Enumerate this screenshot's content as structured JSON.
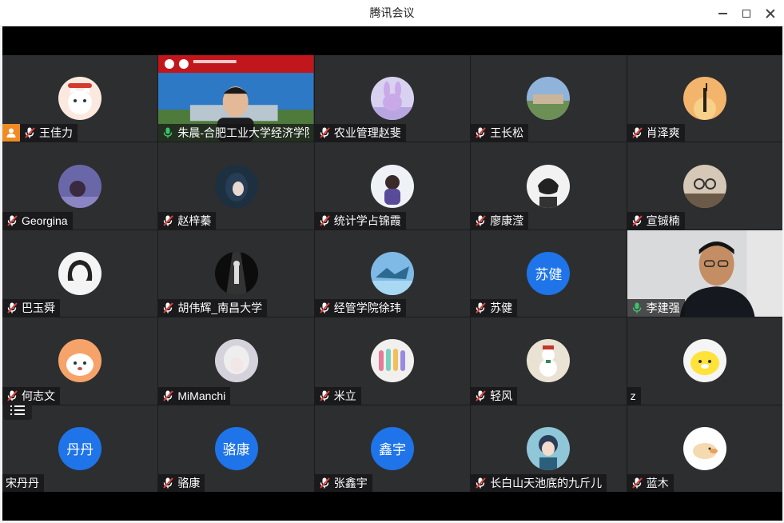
{
  "window": {
    "title": "腾讯会议"
  },
  "participants": [
    {
      "name": "王佳力",
      "avatar": "cat-cartoon-avatar",
      "host": true
    },
    {
      "name": "朱晨-合肥工业大学经济学院",
      "video": true,
      "mic": "on"
    },
    {
      "name": "农业管理赵斐",
      "avatar": "bunny-toy-avatar"
    },
    {
      "name": "王长松",
      "avatar": "campus-building-avatar"
    },
    {
      "name": "肖泽爽",
      "avatar": "sunset-silhouette-avatar"
    },
    {
      "name": "Georgina",
      "avatar": "girl-night-sky-avatar"
    },
    {
      "name": "赵梓蓁",
      "avatar": "anime-girl-avatar"
    },
    {
      "name": "统计学占锦霞",
      "avatar": "child-back-avatar"
    },
    {
      "name": "廖康滢",
      "avatar": "sketch-boy-avatar"
    },
    {
      "name": "宣铖楠",
      "avatar": "glasses-cartoon-avatar"
    },
    {
      "name": "巴玉舜",
      "avatar": "manga-portrait-avatar"
    },
    {
      "name": "胡伟辉_南昌大学",
      "avatar": "stage-figure-avatar"
    },
    {
      "name": "经管学院徐玮",
      "avatar": "ice-landscape-avatar"
    },
    {
      "name": "苏健",
      "avatar_text": "苏健"
    },
    {
      "name": "李建强",
      "video": true,
      "mic": "on",
      "active": true
    },
    {
      "name": "何志文",
      "avatar": "shiba-dog-avatar"
    },
    {
      "name": "MiManchi",
      "avatar": "anime-white-hair-avatar"
    },
    {
      "name": "米立",
      "avatar": "nail-polish-avatar"
    },
    {
      "name": "轻风",
      "avatar": "snowman-avatar"
    },
    {
      "name": "z",
      "avatar": "yellow-bear-avatar",
      "no_mic": true
    },
    {
      "name": "宋丹丹",
      "avatar_text": "丹丹",
      "no_mic": true
    },
    {
      "name": "骆康",
      "avatar_text": "骆康"
    },
    {
      "name": "张鑫宇",
      "avatar_text": "鑫宇"
    },
    {
      "name": "长白山天池底的九斤儿",
      "avatar": "anime-boy-avatar"
    },
    {
      "name": "蓝木",
      "avatar": "duck-plush-avatar"
    }
  ],
  "colors": {
    "tile": "#2d2e30",
    "avatar_blue": "#1e74e8",
    "mic_muted": "#e0403a",
    "mic_on": "#3ac46a",
    "host_badge": "#f08a22"
  }
}
